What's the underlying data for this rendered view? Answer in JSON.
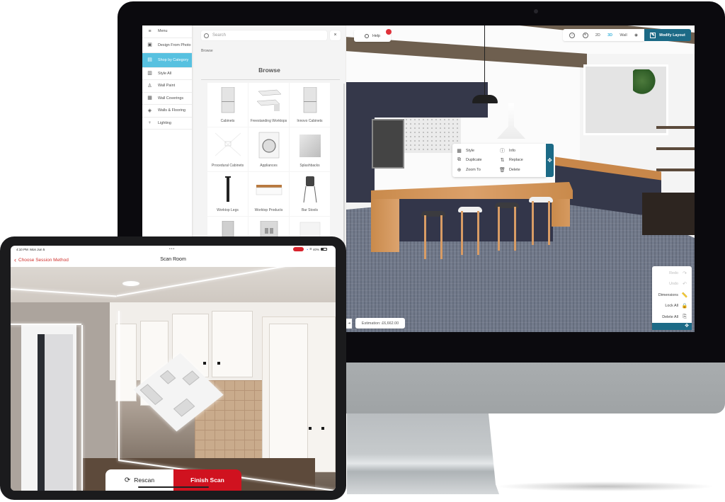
{
  "desktop_app": {
    "sidebar": {
      "items": [
        {
          "label": "Menu",
          "icon": "hamburger-icon"
        },
        {
          "label": "Design From Photo",
          "icon": "photo-design-icon"
        },
        {
          "label": "Shop by Category",
          "icon": "category-icon",
          "active": true
        },
        {
          "label": "Style All",
          "icon": "style-all-icon"
        },
        {
          "label": "Wall Paint",
          "icon": "paint-bucket-icon"
        },
        {
          "label": "Wall Coverings",
          "icon": "wall-coverings-icon"
        },
        {
          "label": "Walls & Flooring",
          "icon": "flooring-icon"
        },
        {
          "label": "Lighting",
          "icon": "lightbulb-icon"
        }
      ]
    },
    "browse": {
      "search_placeholder": "Search",
      "close_label": "×",
      "breadcrumb": "Browse",
      "title": "Browse",
      "categories": [
        {
          "label": "Cabinets"
        },
        {
          "label": "Freestanding Worktops"
        },
        {
          "label": "Innovo Cabinets"
        },
        {
          "label": "Procedural Cabinets"
        },
        {
          "label": "Appliances"
        },
        {
          "label": "Splashbacks"
        },
        {
          "label": "Worktop Legs"
        },
        {
          "label": "Worktop Products"
        },
        {
          "label": "Bar Stools"
        },
        {
          "label": ""
        },
        {
          "label": ""
        },
        {
          "label": ""
        }
      ]
    },
    "toolbar": {
      "help_label": "Help",
      "zoom_out_icon": "⊖",
      "zoom_in_icon": "⊕",
      "view_2d": "2D",
      "view_3d": "3D",
      "view_wall": "Wall",
      "camera_icon": "◉",
      "modify_layout_label": "Modify Layout"
    },
    "context_menu": {
      "items": [
        {
          "label": "Style",
          "icon": "▦"
        },
        {
          "label": "Info",
          "icon": "ⓘ"
        },
        {
          "label": "Duplicate",
          "icon": "⧉"
        },
        {
          "label": "Replace",
          "icon": "⇅"
        },
        {
          "label": "Zoom To",
          "icon": "⊕"
        },
        {
          "label": "Delete",
          "icon": "🗑"
        }
      ],
      "move_icon": "✥"
    },
    "estimation": {
      "collapse_icon": "⇥",
      "label": "Estimation: £6,662.00"
    },
    "tool_panel": {
      "items": [
        {
          "label": "Redo",
          "icon": "↷",
          "disabled": true
        },
        {
          "label": "Undo",
          "icon": "↶",
          "disabled": true
        },
        {
          "label": "Dimensions",
          "icon": "📏",
          "disabled": false
        },
        {
          "label": "Lock All",
          "icon": "🔒",
          "disabled": false
        },
        {
          "label": "Delete All",
          "icon": "⎘",
          "disabled": false
        }
      ],
      "move_icon": "✥"
    }
  },
  "tablet_app": {
    "status_bar": {
      "time": "4:10 PM",
      "date": "Mon Jun 5",
      "dots": "•••",
      "battery": "40%"
    },
    "nav": {
      "back_label": "Choose Session Method",
      "back_icon": "‹",
      "title": "Scan Room"
    },
    "actions": {
      "rescan_icon": "⟳",
      "rescan_label": "Rescan",
      "finish_label": "Finish Scan"
    }
  },
  "colors": {
    "accent_teal": "#1c6a86",
    "active_blue": "#57c1e0",
    "scan_red": "#d0121f"
  }
}
